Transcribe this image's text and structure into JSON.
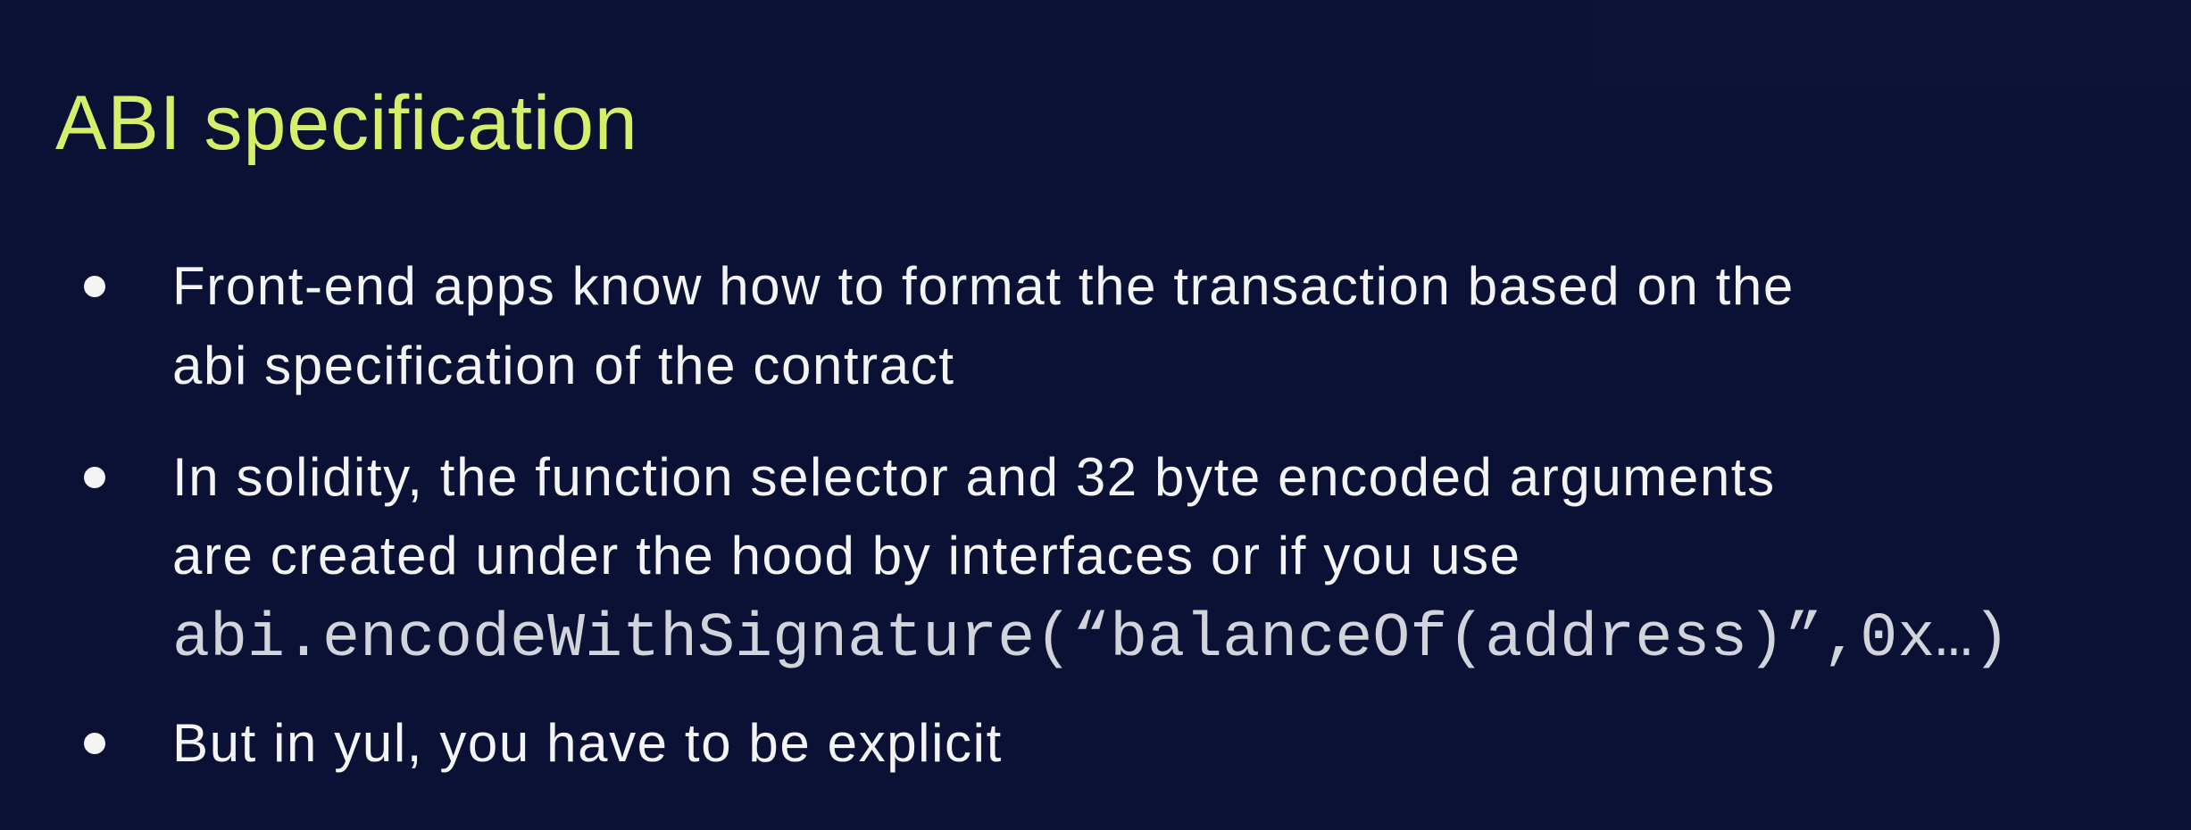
{
  "slide": {
    "title": "ABI specification",
    "bullets": [
      {
        "lines": [
          "Front-end apps know how to format the transaction based on the",
          "abi specification of the contract"
        ]
      },
      {
        "lines": [
          "In solidity, the function selector and 32 byte encoded arguments",
          "are created under the hood by interfaces or if you use"
        ],
        "code": "abi.encodeWithSignature(“balanceOf(address)”,0x…)"
      },
      {
        "lines": [
          "But in yul, you have to be explicit"
        ]
      }
    ]
  },
  "colors": {
    "background": "#0a1134",
    "title": "#d6ef6b",
    "text": "#f4f4f4",
    "code": "#d2d4dc"
  }
}
